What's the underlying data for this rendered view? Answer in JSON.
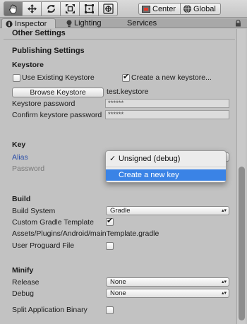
{
  "toolbar": {
    "tools": [
      {
        "name": "hand-tool-icon",
        "glyph": "✋"
      },
      {
        "name": "move-tool-icon",
        "glyph": "✥"
      },
      {
        "name": "rotate-tool-icon",
        "glyph": "⟲"
      },
      {
        "name": "scale-tool-icon",
        "glyph": "⤡"
      },
      {
        "name": "rect-tool-icon",
        "glyph": "▣"
      },
      {
        "name": "transform-tool-icon",
        "glyph": "⊕"
      }
    ],
    "pivot_label": "Center",
    "space_label": "Global"
  },
  "tabs": {
    "inspector": "Inspector",
    "lighting": "Lighting",
    "services": "Services"
  },
  "other_settings_header": "Other Settings",
  "publishing": {
    "title": "Publishing Settings",
    "keystore_heading": "Keystore",
    "use_existing_label": "Use Existing Keystore",
    "use_existing_checked": false,
    "create_new_label": "Create a new keystore...",
    "create_new_checked": true,
    "browse_label": "Browse Keystore",
    "keystore_file": "test.keystore",
    "password_label": "Keystore password",
    "password_value": "******",
    "confirm_label": "Confirm keystore password",
    "confirm_value": "******"
  },
  "key": {
    "heading": "Key",
    "alias_label": "Alias",
    "password_label": "Password",
    "alias_dropdown": {
      "options": [
        "Unsigned (debug)",
        "Create a new key"
      ],
      "checked": "Unsigned (debug)",
      "highlighted": "Create a new key"
    }
  },
  "build": {
    "heading": "Build",
    "system_label": "Build System",
    "system_value": "Gradle",
    "custom_gradle_label": "Custom Gradle Template",
    "custom_gradle_checked": true,
    "gradle_path": "Assets/Plugins/Android/mainTemplate.gradle",
    "proguard_label": "User Proguard File",
    "proguard_checked": false
  },
  "minify": {
    "heading": "Minify",
    "release_label": "Release",
    "release_value": "None",
    "debug_label": "Debug",
    "debug_value": "None"
  },
  "split_binary_label": "Split Application Binary",
  "split_binary_checked": false,
  "colors": {
    "accent": "#3a83e6",
    "alias_label": "#2b4ea8",
    "panel_bg": "#c2c2c2"
  }
}
